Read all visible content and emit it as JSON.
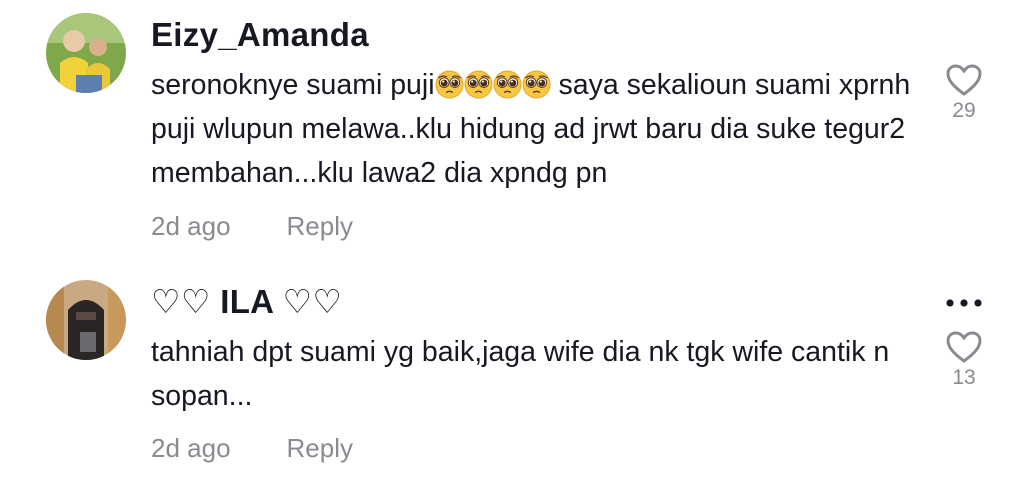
{
  "comments": [
    {
      "username": "Eizy_Amanda",
      "text_before": "seronoknye suami puji",
      "emoji": "pleading-face-emoji",
      "emoji_count": 4,
      "text_after": " saya sekalioun suami xprnh puji wlupun melawa..klu hidung ad jrwt baru dia suke tegur2 membahan...klu lawa2 dia xpndg pn",
      "time": "2d ago",
      "reply_label": "Reply",
      "likes": "29",
      "icon": "heart-outline-icon"
    },
    {
      "username": "♡♡ ILA ♡♡",
      "text": "tahniah dpt suami yg baik,jaga wife dia nk tgk wife cantik n sopan...",
      "time": "2d ago",
      "reply_label": "Reply",
      "likes": "13",
      "icon": "heart-outline-icon",
      "more_icon": "more-options-icon"
    }
  ],
  "colors": {
    "text_primary": "#161823",
    "text_secondary": "#8a8b91",
    "background": "#ffffff"
  }
}
